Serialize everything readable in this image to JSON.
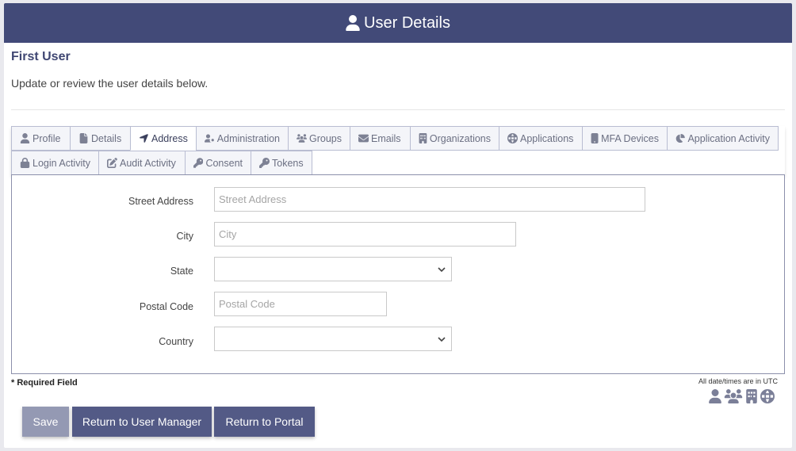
{
  "header": {
    "title": "User Details",
    "icon": "user-icon"
  },
  "user": {
    "name": "First User",
    "subtitle": "Update or review the user details below."
  },
  "tabs": {
    "row1": [
      {
        "label": "Profile",
        "icon": "user-icon"
      },
      {
        "label": "Details",
        "icon": "file-icon"
      },
      {
        "label": "Address",
        "icon": "location-arrow-icon",
        "active": true
      },
      {
        "label": "Administration",
        "icon": "user-cog-icon"
      },
      {
        "label": "Groups",
        "icon": "users-icon"
      },
      {
        "label": "Emails",
        "icon": "envelope-icon"
      },
      {
        "label": "Organizations",
        "icon": "building-icon"
      },
      {
        "label": "Applications",
        "icon": "globe-icon"
      },
      {
        "label": "MFA Devices",
        "icon": "mobile-icon"
      },
      {
        "label": "Application Activity",
        "icon": "pie-chart-icon"
      }
    ],
    "row2": [
      {
        "label": "Login Activity",
        "icon": "lock-icon"
      },
      {
        "label": "Audit Activity",
        "icon": "edit-icon"
      },
      {
        "label": "Consent",
        "icon": "key-icon"
      },
      {
        "label": "Tokens",
        "icon": "key-icon"
      }
    ]
  },
  "form": {
    "street": {
      "label": "Street Address",
      "placeholder": "Street Address",
      "value": ""
    },
    "city": {
      "label": "City",
      "placeholder": "City",
      "value": ""
    },
    "state": {
      "label": "State",
      "value": ""
    },
    "postal": {
      "label": "Postal Code",
      "placeholder": "Postal Code",
      "value": ""
    },
    "country": {
      "label": "Country",
      "value": ""
    }
  },
  "footer": {
    "required_note": "* Required Field",
    "utc_note": "All date/times are in UTC",
    "legend_icons": [
      "user-icon",
      "users-icon",
      "building-icon",
      "globe-icon"
    ]
  },
  "buttons": {
    "save": "Save",
    "return_user_manager": "Return to User Manager",
    "return_portal": "Return to Portal"
  },
  "colors": {
    "header_bg": "#424a78",
    "button_bg": "#535a86",
    "save_disabled_bg": "#9499b3"
  }
}
